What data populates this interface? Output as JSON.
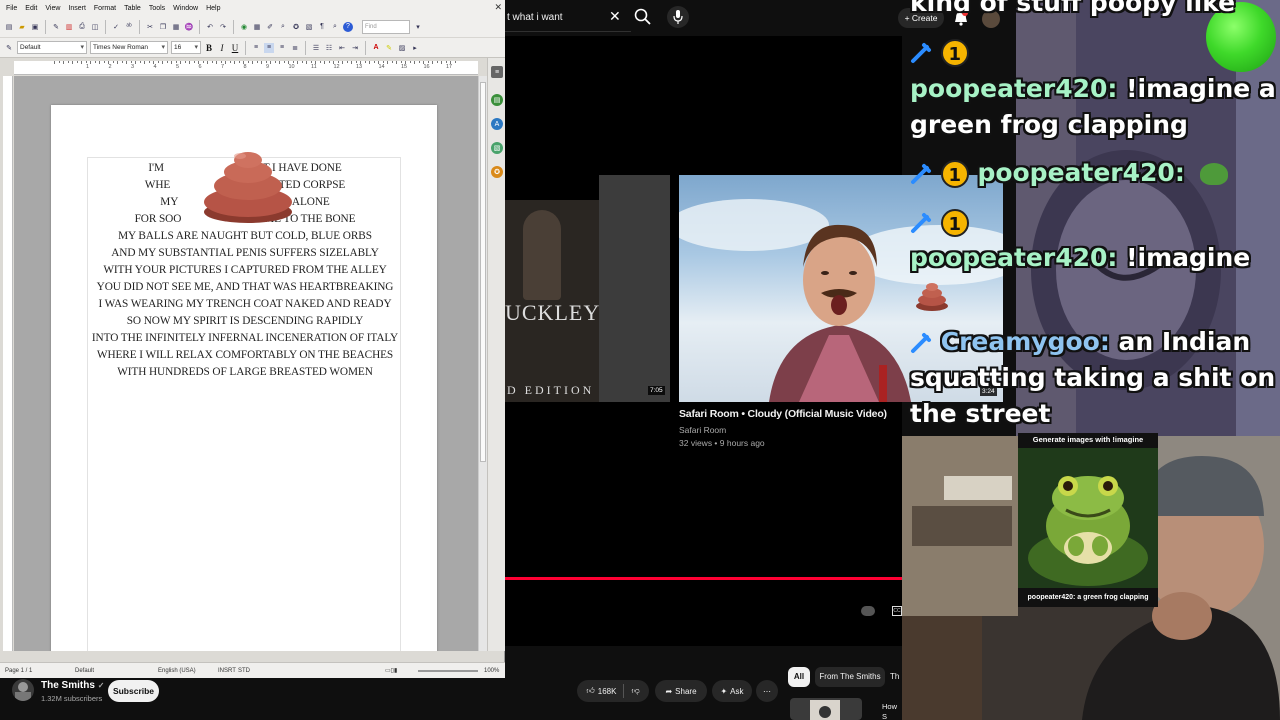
{
  "writer": {
    "menu": [
      "File",
      "Edit",
      "View",
      "Insert",
      "Format",
      "Table",
      "Tools",
      "Window",
      "Help"
    ],
    "find_placeholder": "Find",
    "paragraph_style": "Default",
    "font_name": "Times New Roman",
    "font_size": "16",
    "ruler_numbers": [
      "1",
      "2",
      "3",
      "4",
      "5",
      "6",
      "7",
      "8",
      "9",
      "10",
      "11",
      "12",
      "13",
      "14",
      "15",
      "16",
      "17"
    ],
    "poem_lines": [
      "I'M                                  AT I HAVE DONE",
      "WHE                               SICATED CORPSE",
      "MY                           HANDS ALONE",
      "FOR SOO                        EN ME TO THE BONE",
      "MY BALLS ARE NAUGHT BUT COLD, BLUE ORBS",
      "AND MY SUBSTANTIAL PENIS SUFFERS SIZELABLY",
      "WITH YOUR PICTURES I CAPTURED FROM THE ALLEY",
      "YOU DID NOT SEE ME, AND THAT WAS HEARTBREAKING",
      "I WAS WEARING MY TRENCH COAT NAKED AND READY",
      "SO NOW MY SPIRIT IS DESCENDING RAPIDLY",
      "INTO THE INFINITELY INFERNAL INCENERATION OF ITALY",
      "WHERE I WILL RELAX COMFORTABLY ON THE BEACHES",
      "WITH HUNDREDS OF LARGE BREASTED WOMEN"
    ],
    "status": {
      "page": "Page 1 / 1",
      "style": "Default",
      "language": "English (USA)",
      "insert": "INSRT",
      "selection": "STD",
      "zoom": "100%"
    }
  },
  "youtube": {
    "search_value": "t what i want",
    "endscreen": {
      "left_duration": "7:05",
      "left_text": "UCKLEY",
      "left_edition": "D EDITION",
      "main_duration": "3:24",
      "main_title": "Safari Room • Cloudy (Official Music Video)",
      "main_channel": "Safari Room",
      "main_meta": "32 views • 9 hours ago"
    },
    "channel_name": "The Smiths",
    "channel_subs": "1.32M subscribers",
    "subscribe_label": "Subscribe",
    "likes": "168K",
    "share_label": "Share",
    "ask_label": "Ask",
    "chip_all": "All",
    "chip_channel": "From The Smiths",
    "chip_more": "Th",
    "rec_title": "How S Rema",
    "create_label": "Create"
  },
  "stream": {
    "top_chat": "kind of stuff poopy like",
    "chat": [
      {
        "user": "",
        "text": "",
        "badge": "1"
      },
      {
        "user": "poopeater420:",
        "text": " !imagine a"
      },
      {
        "user": "",
        "text": "green frog clapping"
      },
      {
        "user": "poopeater420:",
        "text": "",
        "badge": "1"
      },
      {
        "user": "",
        "text": "",
        "badge": "1"
      },
      {
        "user": "poopeater420:",
        "text": " !imagine"
      },
      {
        "user": "Creamygoo:",
        "text": " an Indian"
      },
      {
        "user": "",
        "text": "squatting taking a shit on"
      },
      {
        "user": "",
        "text": "the street"
      }
    ],
    "gen_title": "Generate images with !imagine",
    "gen_caption": "poopeater420: a green frog clapping"
  }
}
